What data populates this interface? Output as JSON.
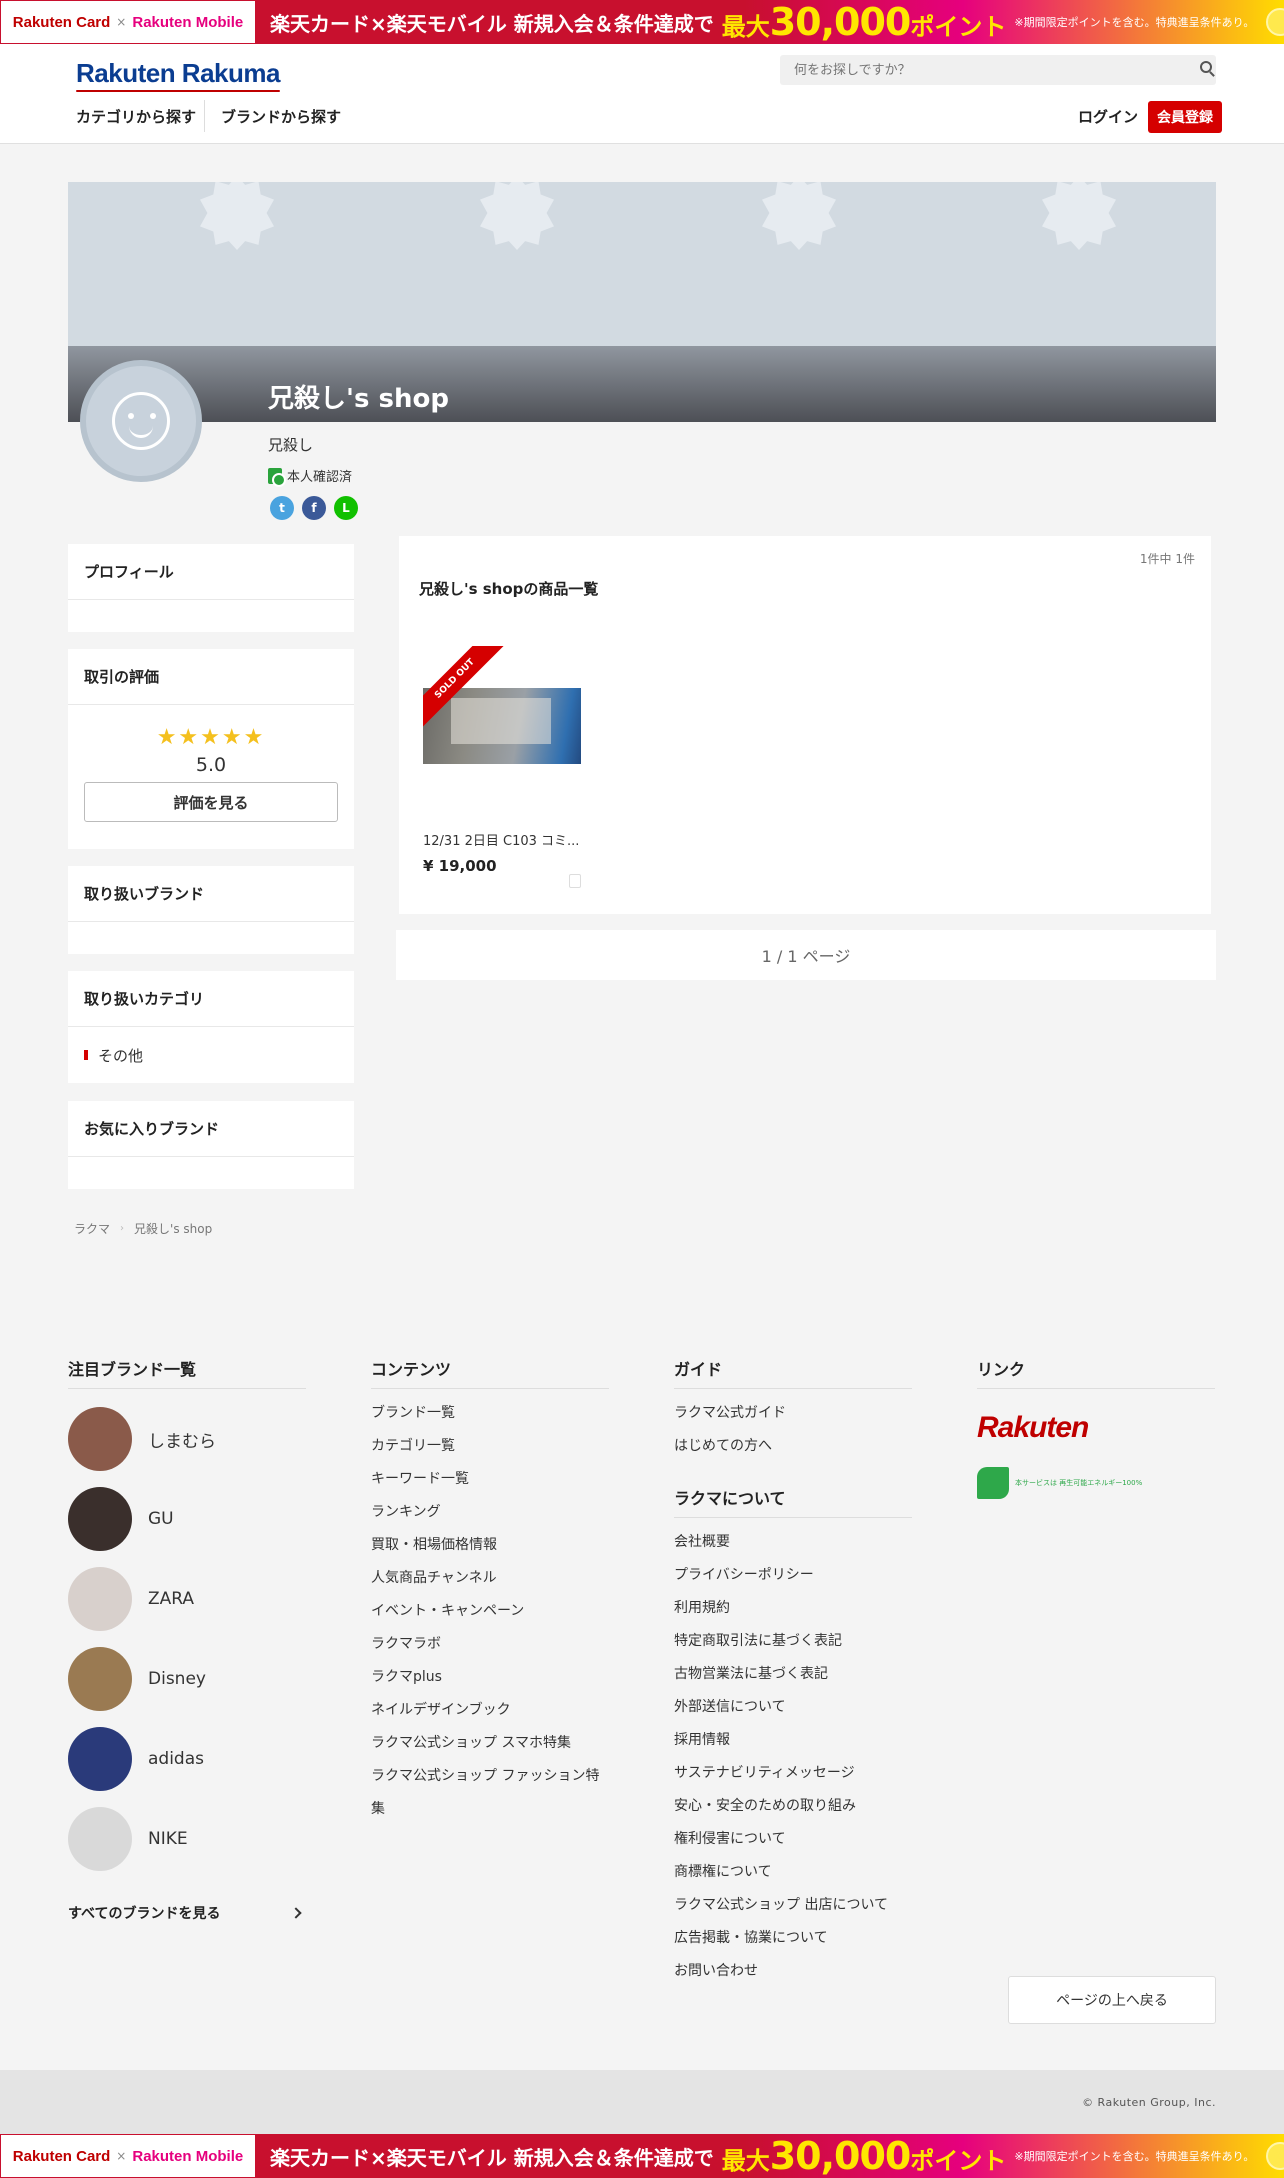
{
  "promo": {
    "card_logo": "Rakuten Card",
    "mobile_logo": "Rakuten Mobile",
    "separator": "×",
    "text": "楽天カード×楽天モバイル 新規入会＆条件達成で",
    "max": "最大",
    "points": "30,000",
    "points_suffix": "ポイント",
    "note": "※期間限定ポイントを含む。特典進呈条件あり。"
  },
  "header": {
    "logo": "Rakuten Rakuma",
    "search_placeholder": "何をお探しですか？",
    "nav": [
      "カテゴリから探す",
      "ブランドから探す"
    ],
    "login": "ログイン",
    "signup": "会員登録"
  },
  "shop": {
    "title": "兄殺し's shop",
    "owner": "兄殺し",
    "verified": "本人確認済"
  },
  "sidebar": {
    "profile": "プロフィール",
    "reviews": "取引の評価",
    "rating": "5.0",
    "stars": "★★★★★",
    "review_button": "評価を見る",
    "brands": "取り扱いブランド",
    "categories": "取り扱いカテゴリ",
    "category_items": [
      "その他"
    ],
    "fav_brands": "お気に入りブランド"
  },
  "items": {
    "count": "1件中 1件",
    "title": "兄殺し's shopの商品一覧",
    "list": [
      {
        "name": "12/31 2日目 C103 コミ...",
        "price": "¥ 19,000",
        "badge": "SOLD OUT"
      }
    ],
    "pager": "1 / 1 ページ"
  },
  "breadcrumb": [
    "ラクマ",
    "兄殺し's shop"
  ],
  "footer": {
    "brands_head": "注目ブランド一覧",
    "brands": [
      {
        "name": "しまむら",
        "color": "#8a5a4a"
      },
      {
        "name": "GU",
        "color": "#3a2f2c"
      },
      {
        "name": "ZARA",
        "color": "#d8d0cc"
      },
      {
        "name": "Disney",
        "color": "#9a7a52"
      },
      {
        "name": "adidas",
        "color": "#2a3a7a"
      },
      {
        "name": "NIKE",
        "color": "#d9d9d9"
      }
    ],
    "all_brands": "すべてのブランドを見る",
    "contents_head": "コンテンツ",
    "contents": [
      "ブランド一覧",
      "カテゴリ一覧",
      "キーワード一覧",
      "ランキング",
      "買取・相場価格情報",
      "人気商品チャンネル",
      "イベント・キャンペーン",
      "ラクマラボ",
      "ラクマplus",
      "ネイルデザインブック",
      "ラクマ公式ショップ スマホ特集",
      "ラクマ公式ショップ ファッション特集"
    ],
    "guide_head": "ガイド",
    "guide": [
      "ラクマ公式ガイド",
      "はじめての方へ"
    ],
    "about_head": "ラクマについて",
    "about": [
      "会社概要",
      "プライバシーポリシー",
      "利用規約",
      "特定商取引法に基づく表記",
      "古物営業法に基づく表記",
      "外部送信について",
      "採用情報",
      "サステナビリティメッセージ",
      "安心・安全のための取り組み",
      "権利侵害について",
      "商標権について",
      "ラクマ公式ショップ 出店について",
      "広告掲載・協業について",
      "お問い合わせ"
    ],
    "links_head": "リンク",
    "rakuten": "Rakuten",
    "green_text": "本サービスは 再生可能エネルギー100%",
    "back_top": "ページの上へ戻る",
    "copyright": "© Rakuten Group, Inc."
  }
}
